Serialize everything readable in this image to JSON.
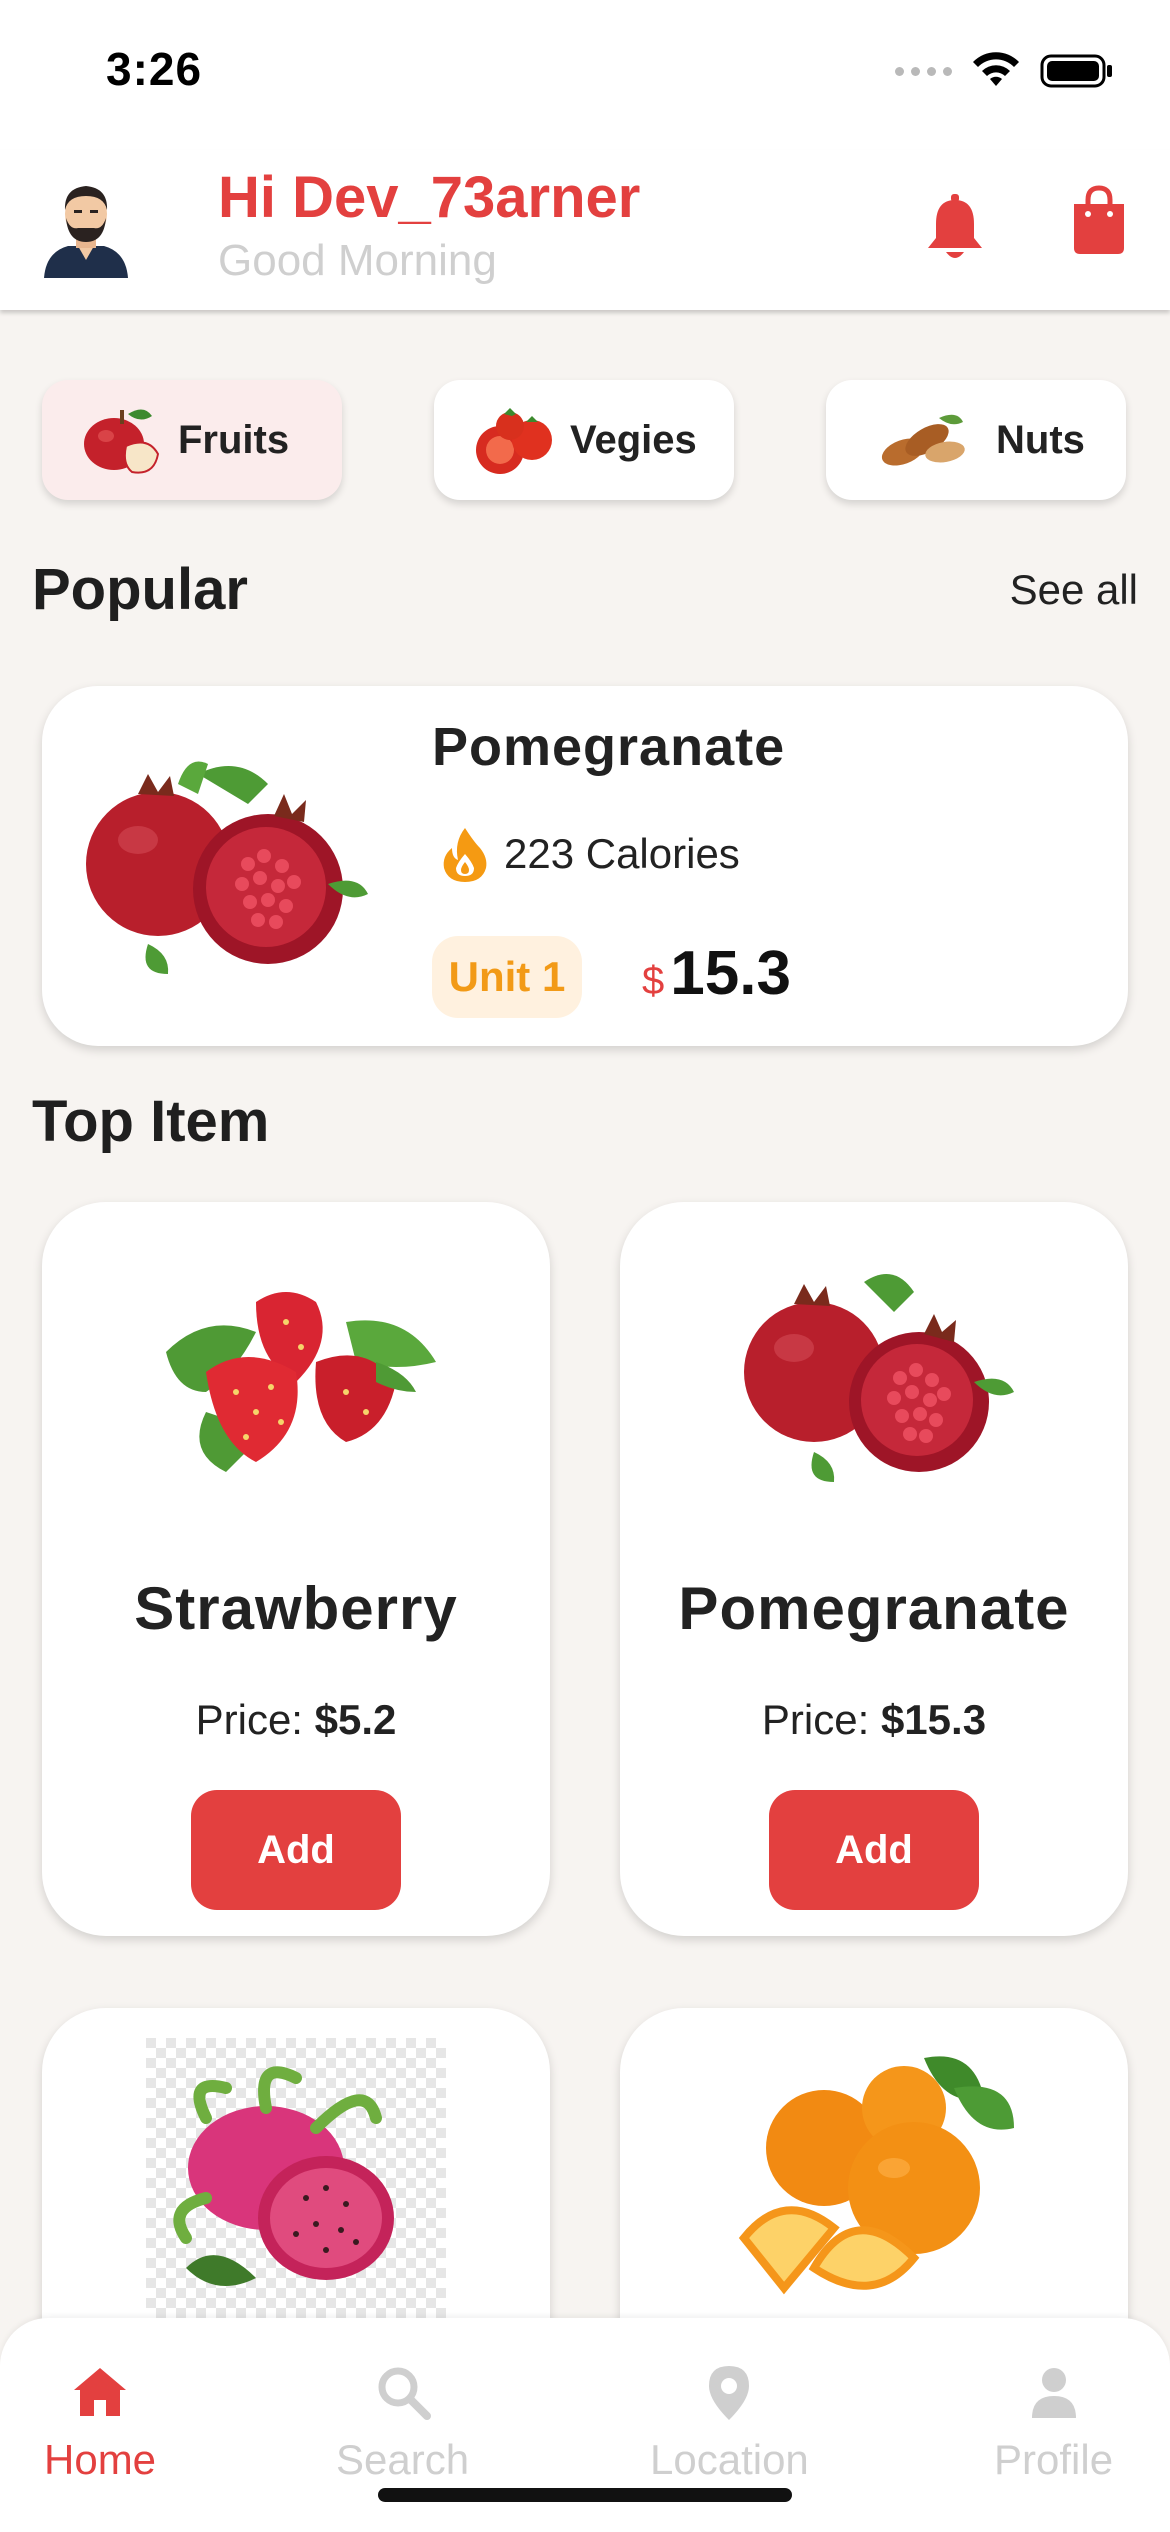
{
  "status_bar": {
    "time": "3:26"
  },
  "header": {
    "greeting": "Hi Dev_73arner",
    "subtitle": "Good Morning"
  },
  "categories": [
    {
      "label": "Fruits",
      "active": true
    },
    {
      "label": "Vegies",
      "active": false
    },
    {
      "label": "Nuts",
      "active": false
    }
  ],
  "popular": {
    "title": "Popular",
    "see_all": "See all",
    "item": {
      "name": "Pomegranate",
      "calories": "223 Calories",
      "unit": "Unit 1",
      "currency": "$",
      "price": "15.3"
    }
  },
  "top_items": {
    "title": "Top Item",
    "items": [
      {
        "name": "Strawberry",
        "price_label": "Price:",
        "price": "$5.2",
        "button": "Add"
      },
      {
        "name": "Pomegranate",
        "price_label": "Price:",
        "price": "$15.3",
        "button": "Add"
      }
    ]
  },
  "bottom_nav": [
    {
      "label": "Home",
      "icon": "home-icon",
      "active": true
    },
    {
      "label": "Search",
      "icon": "search-icon",
      "active": false
    },
    {
      "label": "Location",
      "icon": "location-pin-icon",
      "active": false
    },
    {
      "label": "Profile",
      "icon": "person-icon",
      "active": false
    }
  ],
  "colors": {
    "accent": "#e3403f",
    "unit_badge": "#f29a17",
    "background": "#f7f4f1"
  }
}
